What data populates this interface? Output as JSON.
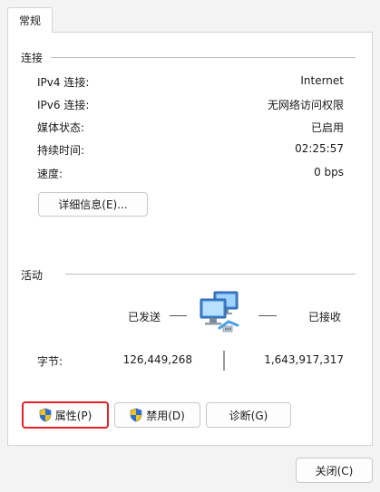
{
  "tab": {
    "label": "常规"
  },
  "connection": {
    "title": "连接",
    "rows": [
      {
        "label": "IPv4 连接:",
        "value": "Internet"
      },
      {
        "label": "IPv6 连接:",
        "value": "无网络访问权限"
      },
      {
        "label": "媒体状态:",
        "value": "已启用"
      },
      {
        "label": "持续时间:",
        "value": "02:25:57"
      },
      {
        "label": "速度:",
        "value": "0 bps"
      }
    ],
    "details_button": "详细信息(E)..."
  },
  "activity": {
    "title": "活动",
    "sent_label": "已发送",
    "received_label": "已接收",
    "bytes_label": "字节:",
    "bytes_sent": "126,449,268",
    "bytes_received": "1,643,917,317"
  },
  "buttons": {
    "properties": "属性(P)",
    "disable": "禁用(D)",
    "diagnose": "诊断(G)",
    "close": "关闭(C)"
  },
  "icons": {
    "network": "network-computers-icon",
    "shield": "uac-shield-icon"
  },
  "colors": {
    "focus_border": "#e8202a"
  }
}
